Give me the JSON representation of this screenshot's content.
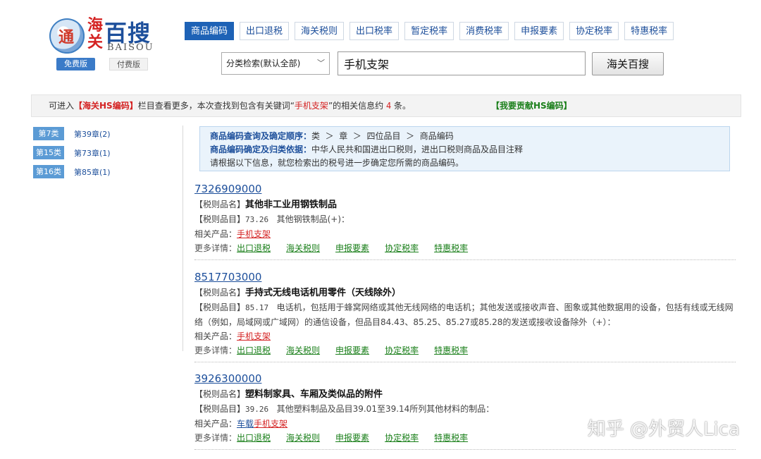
{
  "logo": {
    "mark": "通",
    "haiguan": "海关",
    "cn": "百搜",
    "en": "BAISOU"
  },
  "plans": {
    "free": "免费版",
    "paid": "付费版"
  },
  "nav": [
    "商品编码",
    "出口退税",
    "海关税则",
    "出口税率",
    "暂定税率",
    "消费税率",
    "申报要素",
    "协定税率",
    "特惠税率"
  ],
  "search": {
    "category": "分类检索(默认全部)",
    "value": "手机支架",
    "button": "海关百搜"
  },
  "info": {
    "prefix": "可进入",
    "link": "【海关HS编码】",
    "mid": "栏目查看更多，本次查找到包含有关键词“",
    "keyword": "手机支架",
    "mid2": "”的相关信息约",
    "count": "4",
    "suffix": "条。",
    "contribute": "【我要贡献HS编码】"
  },
  "sidebar": [
    {
      "cat": "第7类",
      "chap": "第39章(2)"
    },
    {
      "cat": "第15类",
      "chap": "第73章(1)"
    },
    {
      "cat": "第16类",
      "chap": "第85章(1)"
    }
  ],
  "guide": {
    "l1_label": "商品编码查询及确定顺序：",
    "l1_text": "类  ＞  章  ＞  四位品目  ＞  商品编码",
    "l2_label": "商品编码确定及归类依据：",
    "l2_text": "中华人民共和国进出口税则，进出口税则商品及品目注释",
    "l3": "请根据以下信息，就您检索出的税号进一步确定您所需的商品编码。"
  },
  "labels": {
    "name": "【税则品名】",
    "heading": "【税则品目】",
    "products": "相关产品：",
    "more": "更多详情："
  },
  "more_links": [
    "出口退税",
    "海关税则",
    "申报要素",
    "协定税率",
    "特惠税率"
  ],
  "results": [
    {
      "code": "7326909000",
      "name": "其他非工业用钢铁制品",
      "heading": "73.26",
      "heading_text": "其他钢铁制品(+)：",
      "product_pre": "",
      "product": "手机支架"
    },
    {
      "code": "8517703000",
      "name": "手持式无线电话机用零件（天线除外）",
      "heading": "85.17",
      "heading_text": "电话机，包括用于蜂窝网络或其他无线网络的电话机；其他发送或接收声音、图象或其他数据用的设备，包括有线或无线网络（例如，局域网或广域网）的通信设备，但品目84.43、85.25、85.27或85.28的发送或接收设备除外（+）：",
      "product_pre": "",
      "product": "手机支架"
    },
    {
      "code": "3926300000",
      "name": "塑料制家具、车厢及类似品的附件",
      "heading": "39.26",
      "heading_text": "其他塑料制品及品目39.01至39.14所列其他材料的制品：",
      "product_pre": "车载",
      "product": "手机支架"
    }
  ],
  "watermark": "知乎 @外贸人Lica"
}
